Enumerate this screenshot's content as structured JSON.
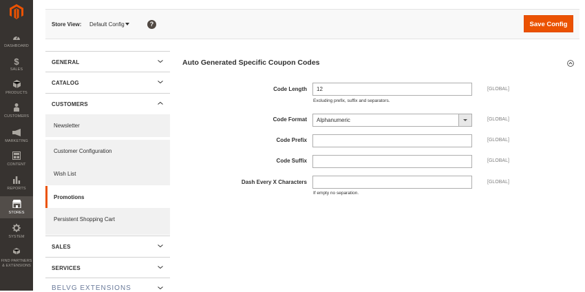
{
  "adminnav": {
    "items": [
      {
        "label": "DASHBOARD",
        "icon": "dashboard-icon"
      },
      {
        "label": "SALES",
        "icon": "dollar-icon"
      },
      {
        "label": "PRODUCTS",
        "icon": "cube-icon"
      },
      {
        "label": "CUSTOMERS",
        "icon": "person-icon"
      },
      {
        "label": "MARKETING",
        "icon": "megaphone-icon"
      },
      {
        "label": "CONTENT",
        "icon": "layout-icon"
      },
      {
        "label": "REPORTS",
        "icon": "bar-chart-icon"
      },
      {
        "label": "STORES",
        "icon": "storefront-icon"
      },
      {
        "label": "SYSTEM",
        "icon": "gear-icon"
      },
      {
        "label": "FIND PARTNERS",
        "label2": "& EXTENSIONS",
        "icon": "cubes-icon"
      }
    ],
    "active": "STORES"
  },
  "header": {
    "store_view_label": "Store View:",
    "store_view_value": "Default Config",
    "help": "?",
    "save_label": "Save Config"
  },
  "sections": {
    "general": "GENERAL",
    "catalog": "CATALOG",
    "customers": "CUSTOMERS",
    "customers_items": [
      "Newsletter",
      "Customer Configuration",
      "Wish List",
      "Promotions",
      "Persistent Shopping Cart"
    ],
    "customers_active": "Promotions",
    "sales": "SALES",
    "services": "SERVICES",
    "belvg": "BELVG EXTENSIONS"
  },
  "main": {
    "title": "Auto Generated Specific Coupon Codes",
    "fields": {
      "code_length": {
        "label": "Code Length",
        "value": "12",
        "note": "Excluding prefix, suffix and separators.",
        "scope": "[GLOBAL]"
      },
      "code_format": {
        "label": "Code Format",
        "value": "Alphanumeric",
        "scope": "[GLOBAL]"
      },
      "code_prefix": {
        "label": "Code Prefix",
        "value": "",
        "scope": "[GLOBAL]"
      },
      "code_suffix": {
        "label": "Code Suffix",
        "value": "",
        "scope": "[GLOBAL]"
      },
      "dash_every": {
        "label": "Dash Every X Characters",
        "value": "",
        "note": "If empty no separation.",
        "scope": "[GLOBAL]"
      }
    }
  },
  "colors": {
    "accent": "#eb5202",
    "nav_bg": "#373330",
    "nav_active": "#524d49"
  }
}
